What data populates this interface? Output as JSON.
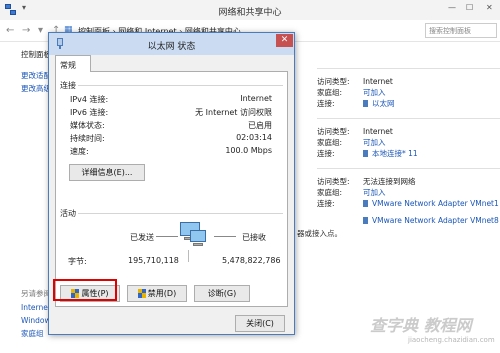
{
  "window": {
    "title": "网络和共享中心",
    "breadcrumb": "控制面板  ›  网络和 Internet  ›  网络和共享中心",
    "search_placeholder": "搜索控制面板",
    "minimize": "—",
    "maximize": "☐",
    "close": "✕"
  },
  "left_nav": {
    "item1": "控制面板主页",
    "item2": "更改适配器设置",
    "item3": "更改高级共享设置",
    "see_also": "另请参阅",
    "item4": "Internet 选项",
    "item5": "Windows 防火墙",
    "item6": "家庭组"
  },
  "networks": [
    {
      "access_type_label": "访问类型:",
      "access_type": "Internet",
      "homegroup_label": "家庭组:",
      "homegroup": "可加入",
      "connection_label": "连接:",
      "connection": "以太网"
    },
    {
      "access_type_label": "访问类型:",
      "access_type": "Internet",
      "homegroup_label": "家庭组:",
      "homegroup": "可加入",
      "connection_label": "连接:",
      "connection": "本地连接* 11"
    },
    {
      "access_type_label": "访问类型:",
      "access_type": "无法连接到网络",
      "homegroup_label": "家庭组:",
      "homegroup": "可加入",
      "connection_label": "连接:",
      "connection": "VMware Network Adapter VMnet1",
      "connection2": "VMware Network Adapter VMnet8"
    }
  ],
  "bg_snippets": {
    "router_hint": "器或接入点。"
  },
  "dialog": {
    "title": "以太网 状态",
    "close": "✕",
    "tab": "常规",
    "connection_header": "连接",
    "rows": [
      {
        "label": "IPv4 连接:",
        "value": "Internet"
      },
      {
        "label": "IPv6 连接:",
        "value": "无 Internet 访问权限"
      },
      {
        "label": "媒体状态:",
        "value": "已启用"
      },
      {
        "label": "持续时间:",
        "value": "02:03:14"
      },
      {
        "label": "速度:",
        "value": "100.0 Mbps"
      }
    ],
    "details_button": "详细信息(E)...",
    "activity_header": "活动",
    "sent_label": "已发送",
    "received_label": "已接收",
    "bytes_label": "字节:",
    "bytes_sent": "195,710,118",
    "bytes_received": "5,478,822,786",
    "properties_button": "属性(P)",
    "disable_button": "禁用(D)",
    "diagnose_button": "诊断(G)",
    "close_button": "关闭(C)"
  },
  "watermark": {
    "text": "查字典 教程网",
    "url": "jiaocheng.chazidian.com"
  }
}
